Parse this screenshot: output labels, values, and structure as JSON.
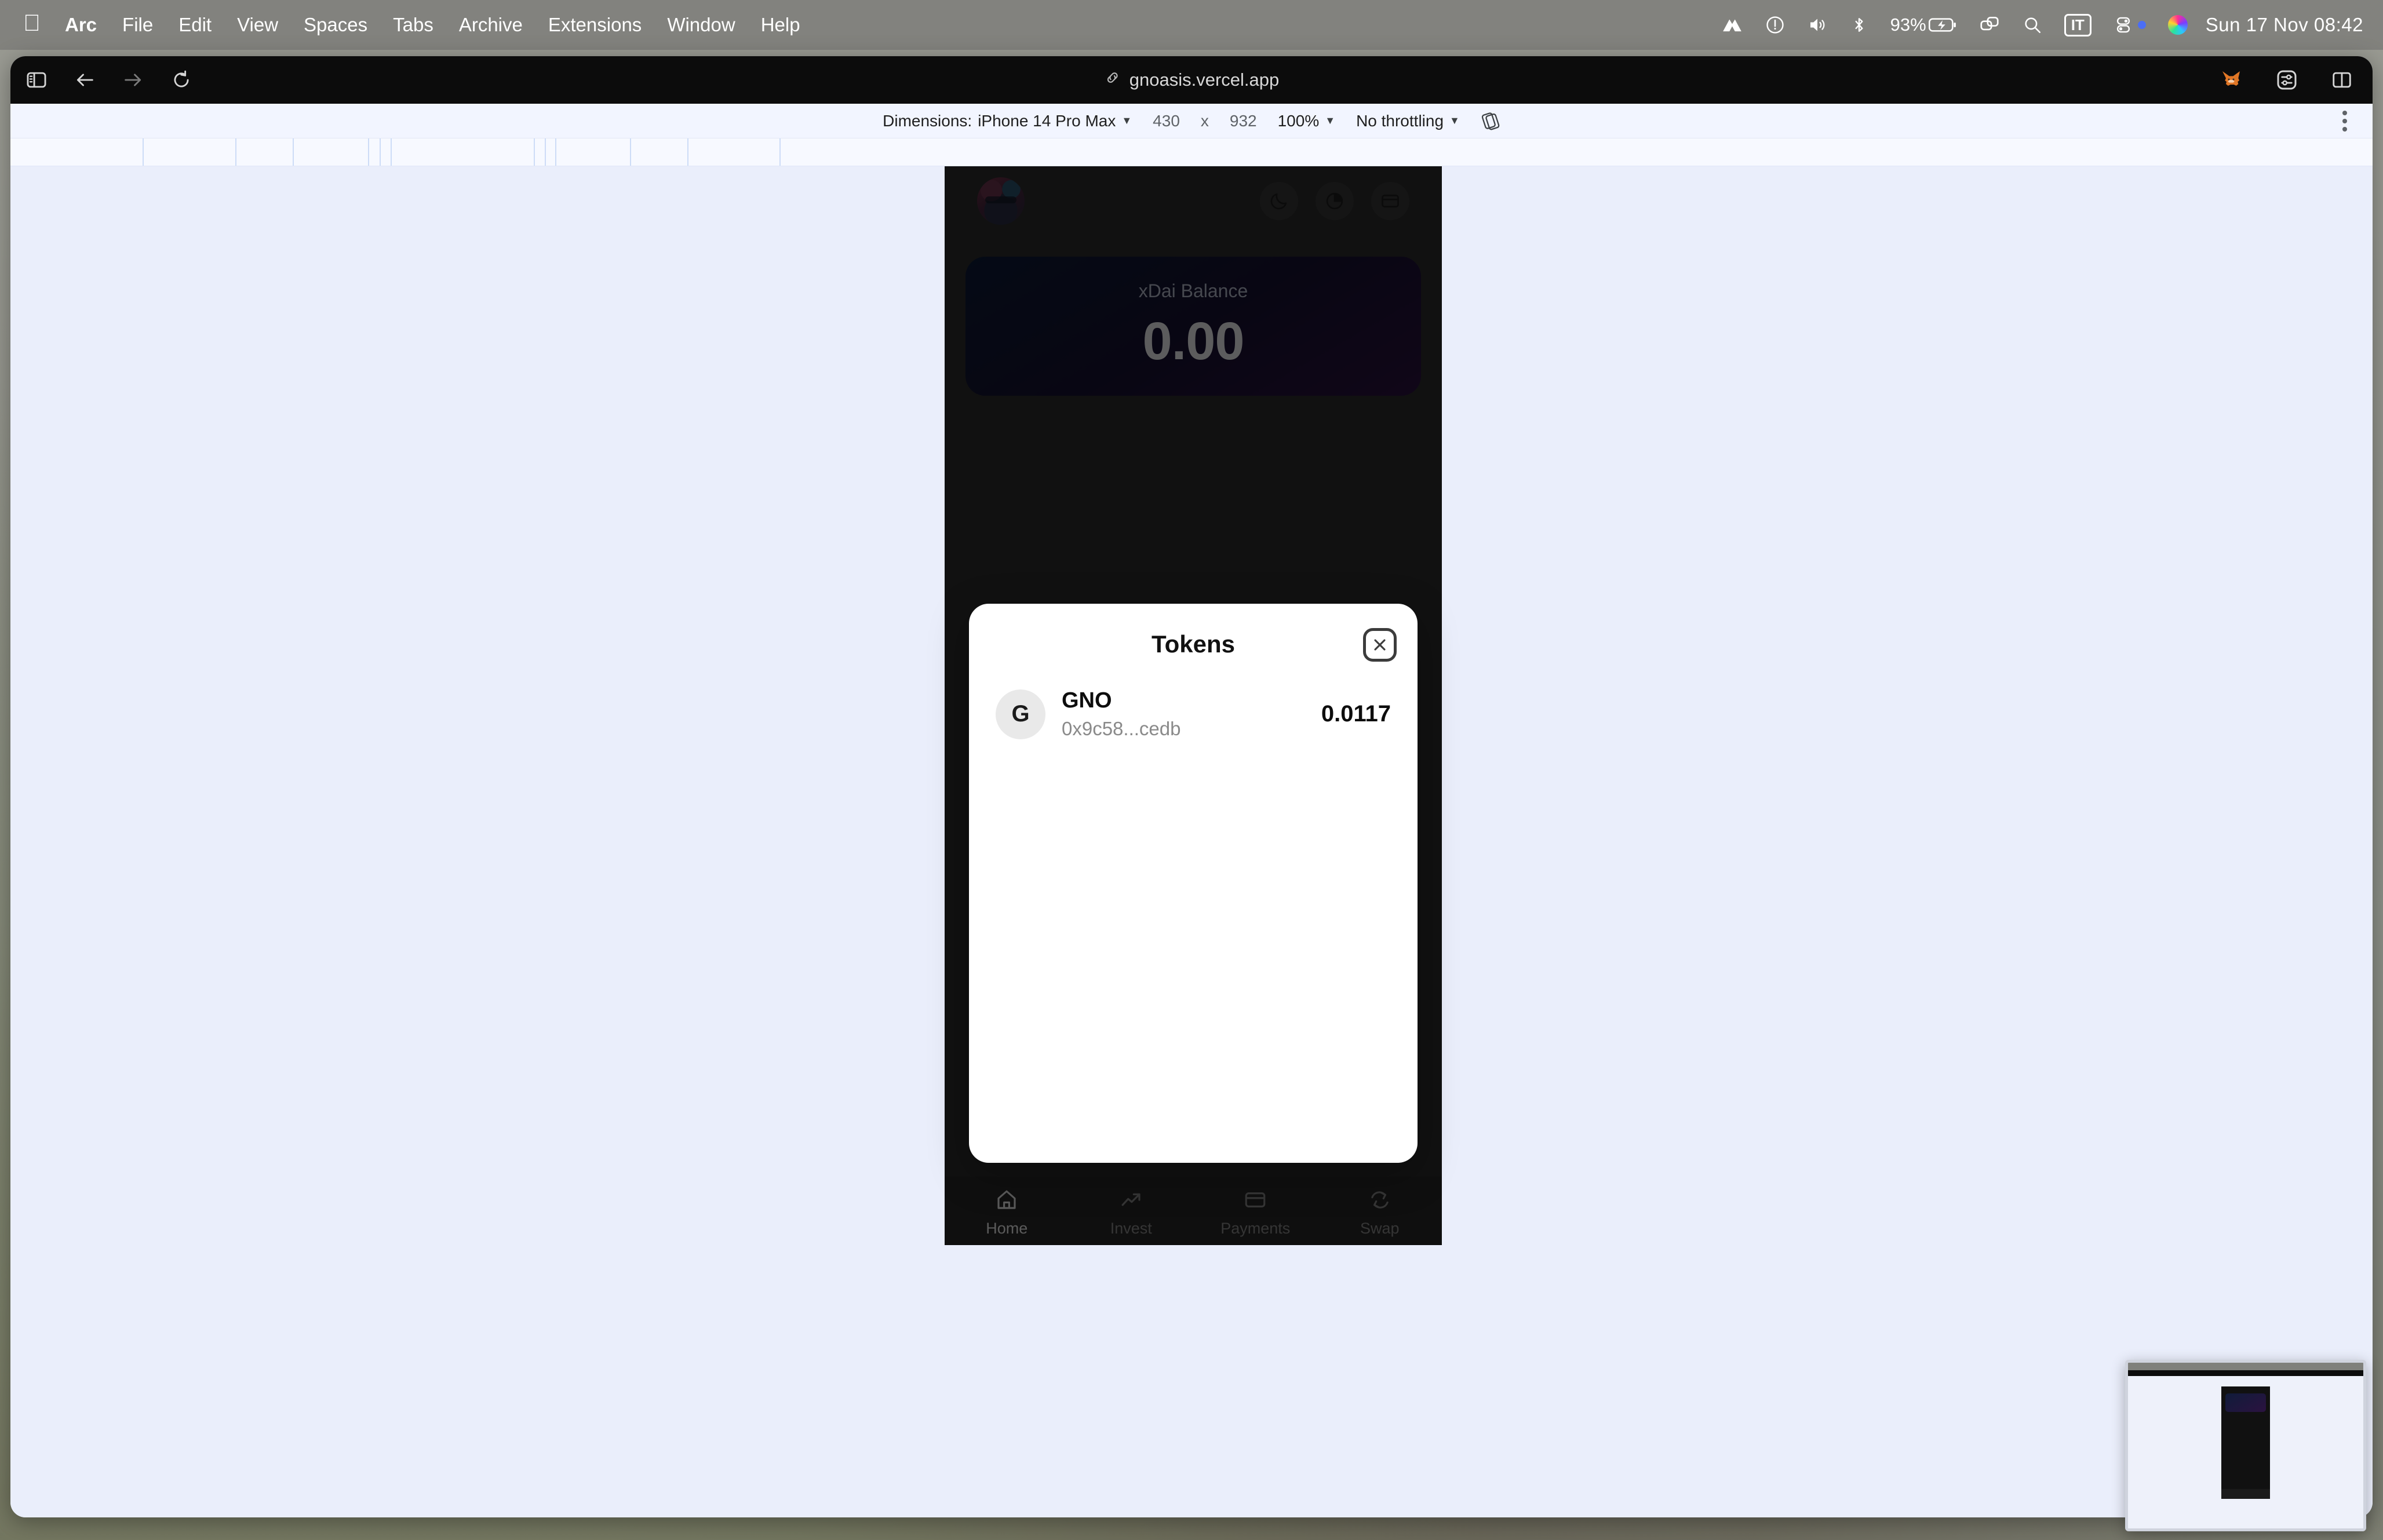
{
  "menubar": {
    "apple_icon": "apple-logo-icon",
    "items": [
      {
        "label": "Arc",
        "bold": true
      },
      {
        "label": "File"
      },
      {
        "label": "Edit"
      },
      {
        "label": "View"
      },
      {
        "label": "Spaces"
      },
      {
        "label": "Tabs"
      },
      {
        "label": "Archive"
      },
      {
        "label": "Extensions"
      },
      {
        "label": "Window"
      },
      {
        "label": "Help"
      }
    ],
    "status": {
      "vpn_icon": "nordvpn-icon",
      "warning_icon": "warning-circle-icon",
      "volume_icon": "volume-icon",
      "bluetooth_icon": "bluetooth-icon",
      "battery_percent": "93%",
      "battery_icon": "battery-charging-icon",
      "screenshare_icon": "screen-share-icon",
      "search_icon": "spotlight-search-icon",
      "keyboard_layout": "IT",
      "control_center_icon": "control-center-icon",
      "siri_icon": "siri-icon",
      "clock": "Sun 17 Nov  08:42"
    }
  },
  "browser": {
    "sidebar_toggle_icon": "sidebar-toggle-icon",
    "back_icon": "back-arrow-icon",
    "forward_icon": "forward-arrow-icon",
    "reload_icon": "reload-icon",
    "url_link_icon": "link-icon",
    "url": "gnoasis.vercel.app",
    "metamask_icon": "metamask-fox-icon",
    "extension_settings_icon": "sliders-icon",
    "split_view_icon": "split-view-icon"
  },
  "devtools": {
    "dimensions_label": "Dimensions:",
    "device_preset": "iPhone 14 Pro Max",
    "width": "430",
    "times": "x",
    "height": "932",
    "zoom": "100%",
    "throttling": "No throttling",
    "rotate_icon": "rotate-device-icon",
    "menu_icon": "kebab-menu-icon"
  },
  "app": {
    "avatar_name": "user-avatar",
    "header_actions": [
      {
        "name": "dark-mode-toggle",
        "icon": "moon-icon"
      },
      {
        "name": "portfolio-button",
        "icon": "pie-chart-icon"
      },
      {
        "name": "cards-button",
        "icon": "credit-card-icon"
      }
    ],
    "balance": {
      "label": "xDai Balance",
      "value": "0.00"
    },
    "bottom_nav": [
      {
        "label": "Home",
        "icon": "home-icon",
        "active": true
      },
      {
        "label": "Invest",
        "icon": "trending-up-icon",
        "active": false
      },
      {
        "label": "Payments",
        "icon": "credit-card-icon",
        "active": false
      },
      {
        "label": "Swap",
        "icon": "swap-refresh-icon",
        "active": false
      }
    ]
  },
  "modal": {
    "title": "Tokens",
    "close_icon": "close-x-icon",
    "tokens": [
      {
        "initial": "G",
        "symbol": "GNO",
        "address": "0x9c58...cedb",
        "amount": "0.0117"
      }
    ]
  },
  "colors": {
    "page_background": "#eaeefb",
    "phone_background": "#2e2e2e",
    "modal_background": "#ffffff",
    "balance_gradient_start": "#0d1b38",
    "balance_gradient_end": "#2c1240",
    "accent_text": "#111111"
  }
}
